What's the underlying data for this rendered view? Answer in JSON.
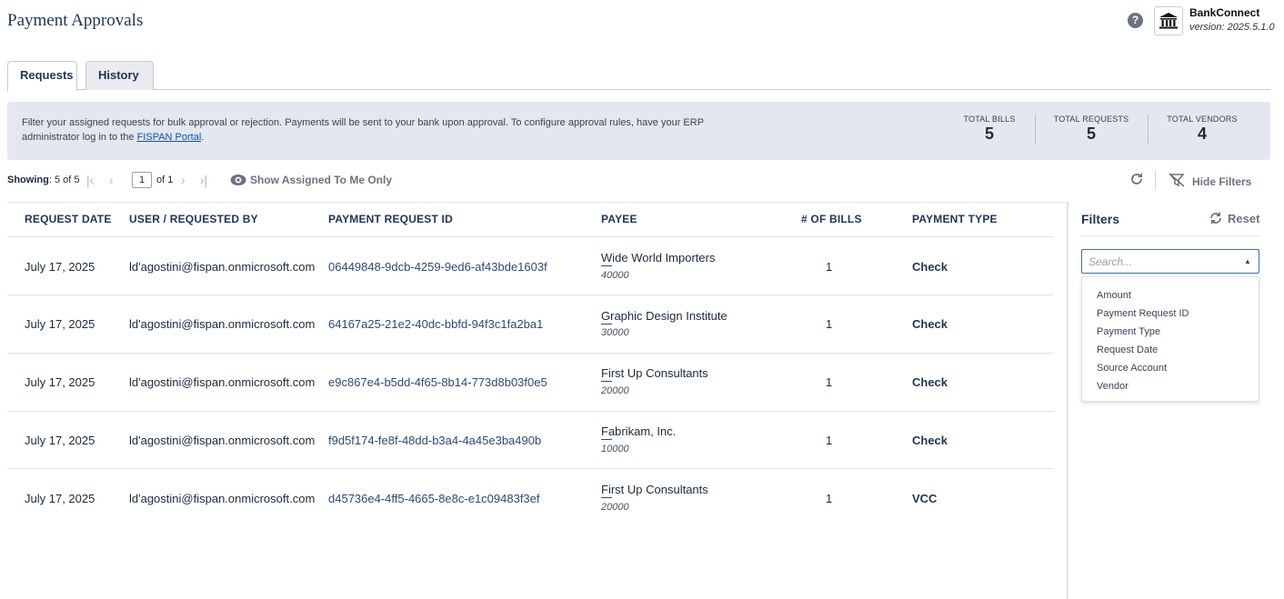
{
  "header": {
    "title": "Payment Approvals",
    "brand_name": "BankConnect",
    "brand_version": "version: 2025.5.1.0",
    "help_icon": "question-circle-icon",
    "logo_icon": "bank-building-icon"
  },
  "tabs": [
    {
      "label": "Requests",
      "active": true
    },
    {
      "label": "History",
      "active": false
    }
  ],
  "info": {
    "text_before_link": "Filter your assigned requests for bulk approval or rejection. Payments will be sent to your bank upon approval. To configure approval rules, have your ERP administrator log in to the ",
    "link_text": "FISPAN Portal",
    "text_after_link": "."
  },
  "stats": [
    {
      "label": "TOTAL BILLS",
      "value": "5"
    },
    {
      "label": "TOTAL REQUESTS",
      "value": "5"
    },
    {
      "label": "TOTAL VENDORS",
      "value": "4"
    }
  ],
  "toolbar": {
    "showing_label": "Showing",
    "showing_value": ": 5 of 5",
    "page_current": "1",
    "page_of": "of 1",
    "show_assigned": "Show Assigned To Me Only",
    "hide_filters": "Hide Filters"
  },
  "table": {
    "columns": [
      "REQUEST DATE",
      "USER / REQUESTED BY",
      "PAYMENT REQUEST ID",
      "PAYEE",
      "# OF BILLS",
      "PAYMENT TYPE"
    ],
    "rows": [
      {
        "date": "July 17, 2025",
        "user": "ld'agostini@fispan.onmicrosoft.com",
        "id": "06449848-9dcb-4259-9ed6-af43bde1603f",
        "payee": "Wide World Importers",
        "amount": "40000",
        "bills": "1",
        "type": "Check"
      },
      {
        "date": "July 17, 2025",
        "user": "ld'agostini@fispan.onmicrosoft.com",
        "id": "64167a25-21e2-40dc-bbfd-94f3c1fa2ba1",
        "payee": "Graphic Design Institute",
        "amount": "30000",
        "bills": "1",
        "type": "Check"
      },
      {
        "date": "July 17, 2025",
        "user": "ld'agostini@fispan.onmicrosoft.com",
        "id": "e9c867e4-b5dd-4f65-8b14-773d8b03f0e5",
        "payee": "First Up Consultants",
        "amount": "20000",
        "bills": "1",
        "type": "Check"
      },
      {
        "date": "July 17, 2025",
        "user": "ld'agostini@fispan.onmicrosoft.com",
        "id": "f9d5f174-fe8f-48dd-b3a4-4a45e3ba490b",
        "payee": "Fabrikam, Inc.",
        "amount": "10000",
        "bills": "1",
        "type": "Check"
      },
      {
        "date": "July 17, 2025",
        "user": "ld'agostini@fispan.onmicrosoft.com",
        "id": "d45736e4-4ff5-4665-8e8c-e1c09483f3ef",
        "payee": "First Up Consultants",
        "amount": "20000",
        "bills": "1",
        "type": "VCC"
      }
    ]
  },
  "filters": {
    "title": "Filters",
    "reset": "Reset",
    "search_placeholder": "Search...",
    "options": [
      "Amount",
      "Payment Request ID",
      "Payment Type",
      "Request Date",
      "Source Account",
      "Vendor"
    ]
  }
}
